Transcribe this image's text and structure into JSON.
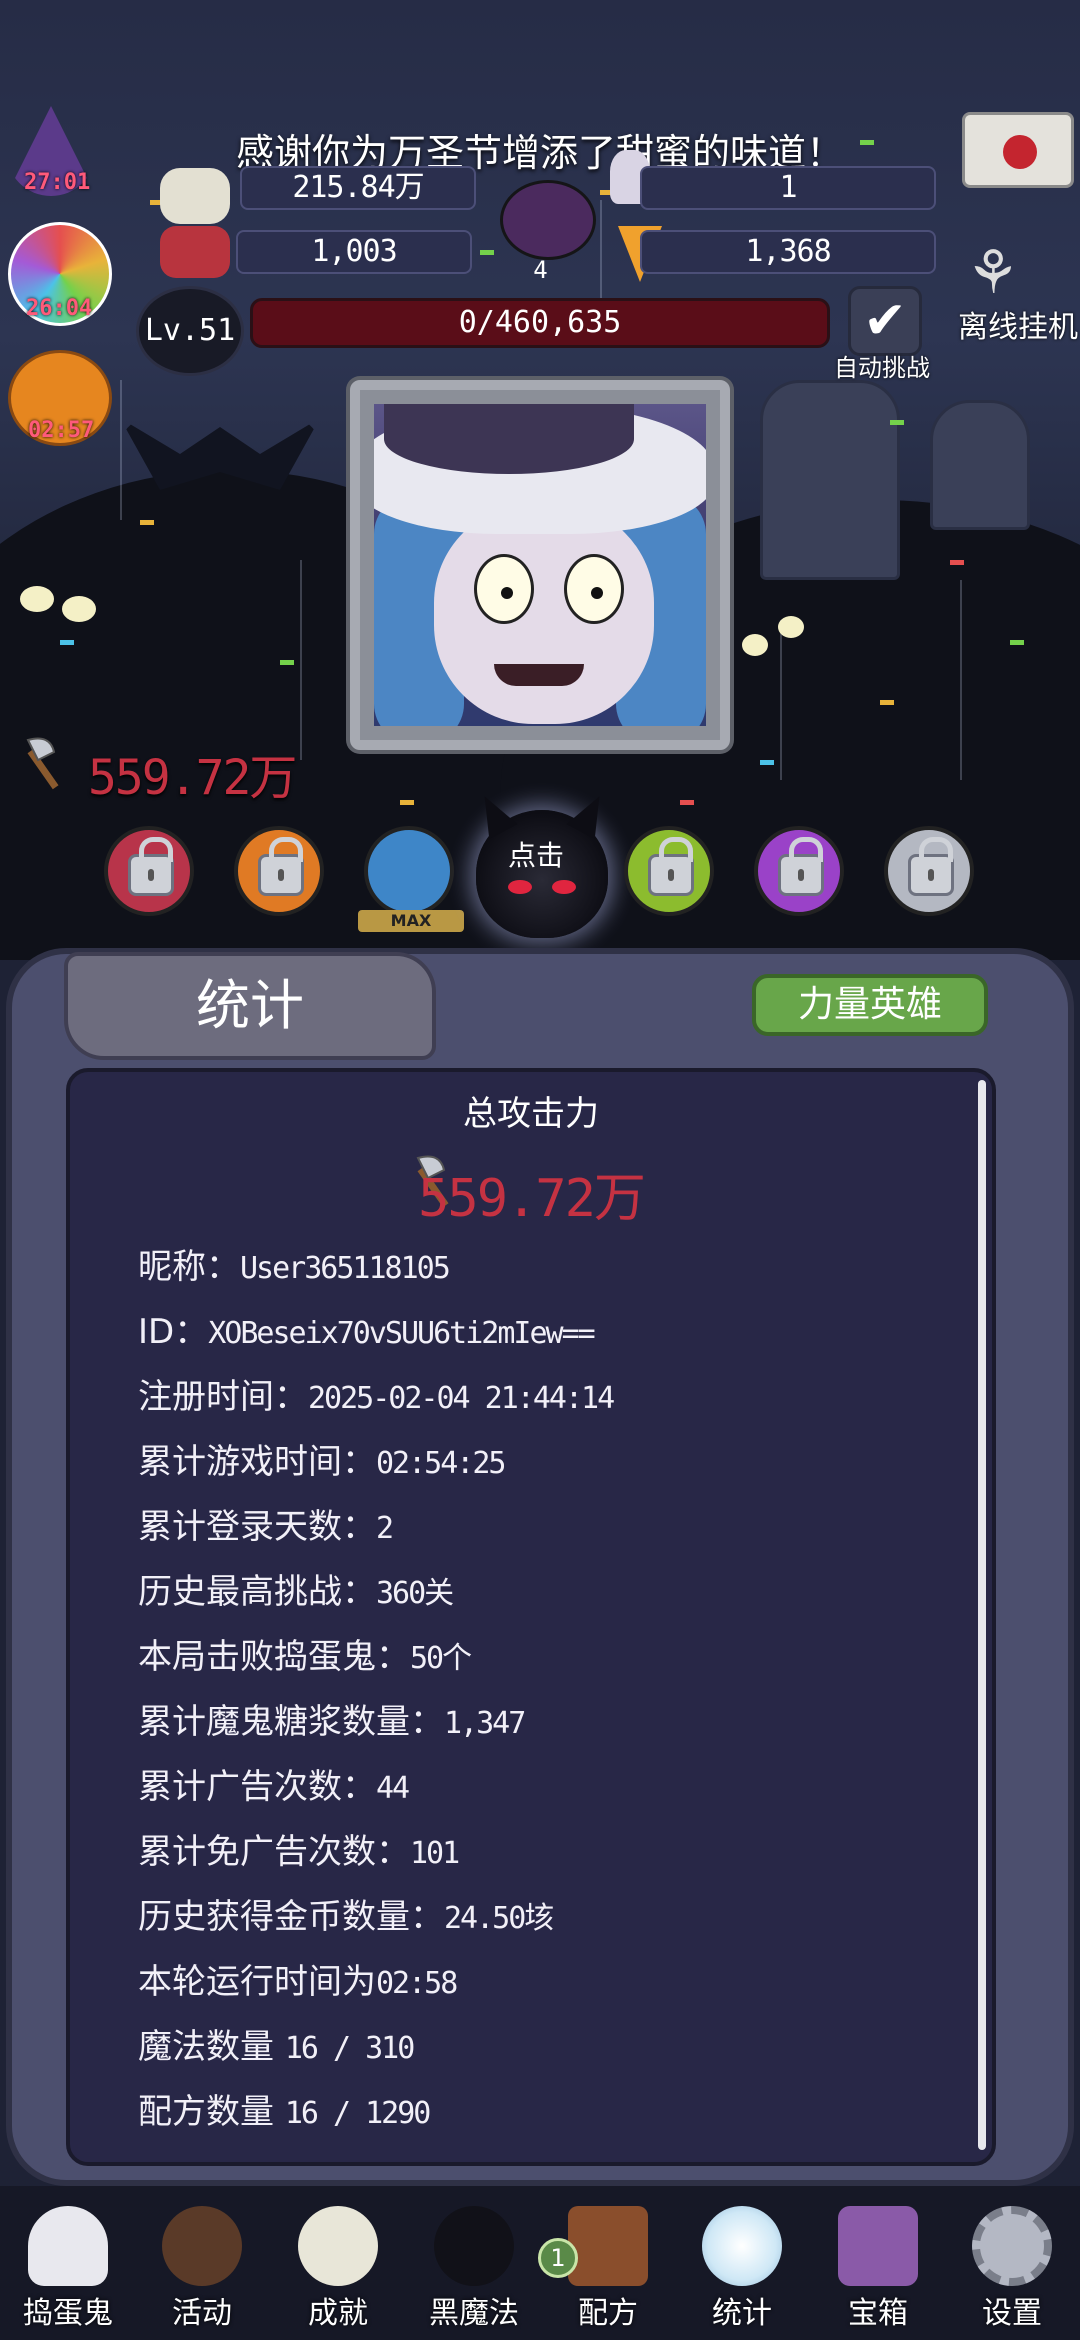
{
  "header": {
    "thanks_message": "感谢你为万圣节增添了甜蜜的味道！",
    "left_badges": [
      "27:01",
      "26:04",
      "02:57"
    ],
    "resources": {
      "coins": "215.84万",
      "potion": "1",
      "candy_bow": "1,003",
      "cauldron": "4",
      "candy_corn": "1,368"
    },
    "level": "Lv.51",
    "hp_text": "0/460,635",
    "hp_fraction": 0,
    "auto_challenge": "自动挑战",
    "offline": "离线挂机"
  },
  "battle": {
    "attack_power": "559.72万",
    "click_label": "点击",
    "max_tag": "MAX"
  },
  "panel": {
    "tab_title": "统计",
    "hero_button": "力量英雄",
    "total_title": "总攻击力",
    "total_value": "559.72万",
    "stats": [
      {
        "label": "昵称：",
        "value": "User365118105"
      },
      {
        "label": "ID：",
        "value": "XOBeseix70vSUU6ti2mIew=="
      },
      {
        "label": "注册时间：",
        "value": "2025-02-04 21:44:14"
      },
      {
        "label": "累计游戏时间：",
        "value": "02:54:25"
      },
      {
        "label": "累计登录天数：",
        "value": "2"
      },
      {
        "label": "历史最高挑战：",
        "value": "360关"
      },
      {
        "label": "本局击败捣蛋鬼：",
        "value": "50个"
      },
      {
        "label": "累计魔鬼糖浆数量：",
        "value": "1,347"
      },
      {
        "label": "累计广告次数：",
        "value": "44"
      },
      {
        "label": "累计免广告次数：",
        "value": "101"
      },
      {
        "label": "历史获得金币数量：",
        "value": "24.50垓"
      },
      {
        "label": "本轮运行时间为",
        "value": "02:58"
      },
      {
        "label": "魔法数量 ",
        "value": "16 / 310"
      },
      {
        "label": "配方数量 ",
        "value": "16 / 1290"
      }
    ]
  },
  "nav": {
    "items": [
      {
        "label": "捣蛋鬼",
        "icon": "ghost-icon"
      },
      {
        "label": "活动",
        "icon": "cupcake-icon"
      },
      {
        "label": "成就",
        "icon": "skull-trophy-icon"
      },
      {
        "label": "黑魔法",
        "icon": "demon-icon"
      },
      {
        "label": "配方",
        "icon": "recipe-book-icon"
      },
      {
        "label": "统计",
        "icon": "crystal-ball-icon"
      },
      {
        "label": "宝箱",
        "icon": "gift-chest-icon"
      },
      {
        "label": "设置",
        "icon": "gear-icon"
      }
    ],
    "recipe_badge": "1"
  },
  "colors": {
    "accent_red": "#c53242",
    "hero_green": "#68a64a",
    "panel_bg": "#282747"
  }
}
